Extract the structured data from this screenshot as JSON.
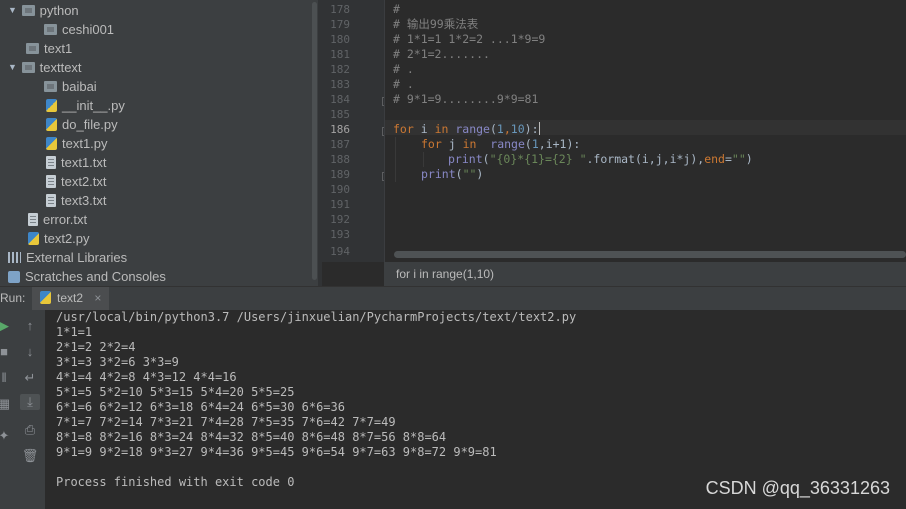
{
  "project_tree": {
    "items": [
      {
        "label": "python",
        "type": "folder",
        "expanded": true
      },
      {
        "label": "ceshi001",
        "type": "folder"
      },
      {
        "label": "text1",
        "type": "folder"
      },
      {
        "label": "texttext",
        "type": "folder",
        "expanded": true
      },
      {
        "label": "baibai",
        "type": "folder"
      },
      {
        "label": "__init__.py",
        "type": "py"
      },
      {
        "label": "do_file.py",
        "type": "py"
      },
      {
        "label": "text1.py",
        "type": "py"
      },
      {
        "label": "text1.txt",
        "type": "txt"
      },
      {
        "label": "text2.txt",
        "type": "txt"
      },
      {
        "label": "text3.txt",
        "type": "txt"
      },
      {
        "label": "error.txt",
        "type": "txt"
      },
      {
        "label": "text2.py",
        "type": "py"
      },
      {
        "label": "External Libraries",
        "type": "lib"
      },
      {
        "label": "Scratches and Consoles",
        "type": "scratch"
      }
    ]
  },
  "editor": {
    "line_numbers": [
      "178",
      "179",
      "180",
      "181",
      "182",
      "183",
      "184",
      "185",
      "186",
      "187",
      "188",
      "189",
      "190",
      "191",
      "192",
      "193",
      "194"
    ],
    "current_line": "186",
    "lines": {
      "l178": "#",
      "l179": "# 输出99乘法表",
      "l180": "# 1*1=1 1*2=2 ...1*9=9",
      "l181": "# 2*1=2.......",
      "l182": "# .",
      "l183": "# .",
      "l184": "# 9*1=9........9*9=81",
      "l186": {
        "kw1": "for",
        "var": " i ",
        "kw2": "in",
        "sp": " ",
        "fn": "range",
        "p1": "(",
        "n1": "1",
        "c": ",",
        "n2": "10",
        "p2": "):"
      },
      "l187": {
        "kw1": "for",
        "var": " j ",
        "kw2": "in",
        "sp": "  ",
        "fn": "range",
        "p1": "(",
        "n1": "1",
        "rest": ",i+1):"
      },
      "l188": {
        "fn": "print",
        "p1": "(",
        "s1": "\"{0}*{1}={2} \"",
        "mid": ".format(i,j,i*j),",
        "kw": "end",
        "eq": "=",
        "s2": "\"\"",
        "p2": ")"
      },
      "l189": {
        "fn": "print",
        "p1": "(",
        "s1": "\"\"",
        "p2": ")"
      }
    },
    "breadcrumb": "for i in range(1,10)"
  },
  "run_panel": {
    "label": "Run:",
    "tab": "text2",
    "output": [
      "/usr/local/bin/python3.7 /Users/jinxuelian/PycharmProjects/text/text2.py",
      "1*1=1",
      "2*1=2 2*2=4",
      "3*1=3 3*2=6 3*3=9",
      "4*1=4 4*2=8 4*3=12 4*4=16",
      "5*1=5 5*2=10 5*3=15 5*4=20 5*5=25",
      "6*1=6 6*2=12 6*3=18 6*4=24 6*5=30 6*6=36",
      "7*1=7 7*2=14 7*3=21 7*4=28 7*5=35 7*6=42 7*7=49",
      "8*1=8 8*2=16 8*3=24 8*4=32 8*5=40 8*6=48 8*7=56 8*8=64",
      "9*1=9 9*2=18 9*3=27 9*4=36 9*5=45 9*6=54 9*7=63 9*8=72 9*9=81",
      "",
      "Process finished with exit code 0"
    ]
  },
  "watermark": "CSDN @qq_36331263",
  "icons": {
    "folder": "folder-icon",
    "py": "python-file-icon",
    "txt": "text-file-icon",
    "lib": "library-icon",
    "scratch": "scratch-icon"
  },
  "colors": {
    "keyword": "#cc7832",
    "builtin": "#8888c6",
    "number": "#6897bb",
    "string": "#6a8759",
    "comment": "#808080",
    "run_green": "#59a869"
  }
}
